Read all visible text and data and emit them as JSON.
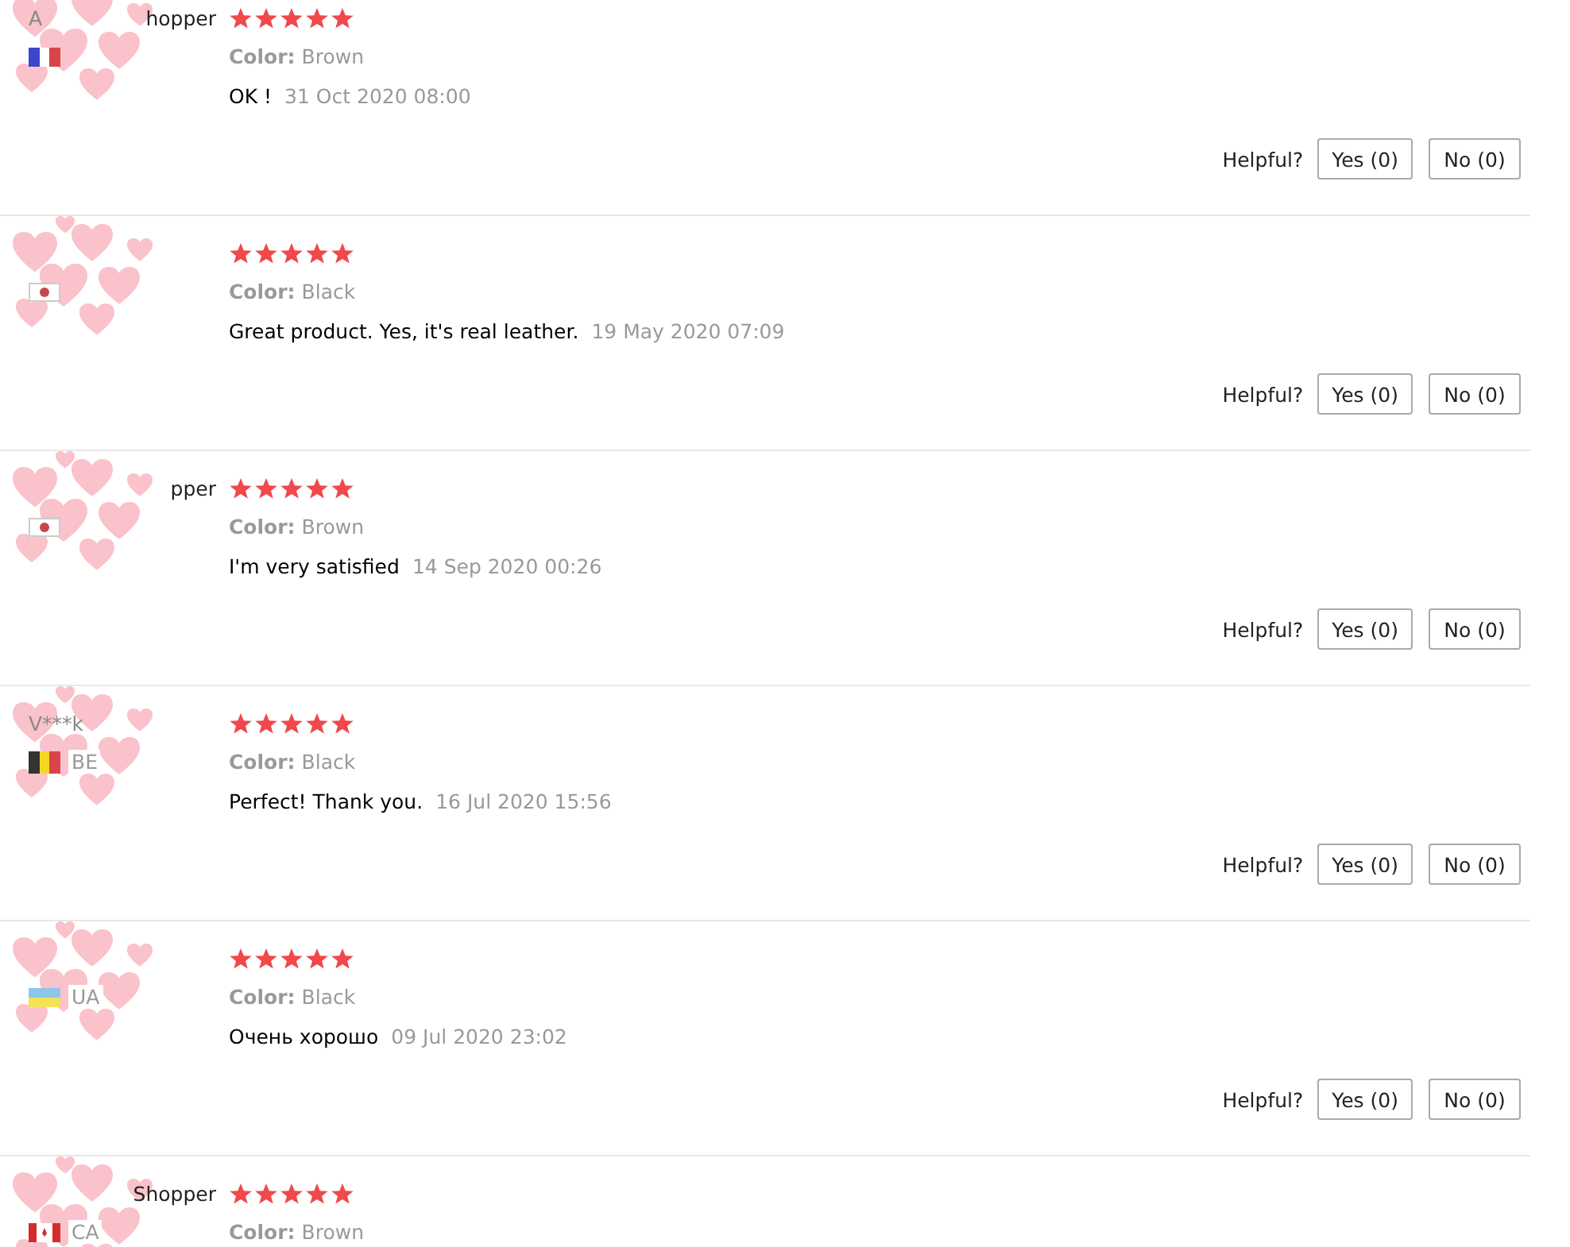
{
  "reviews": [
    {
      "user_name": "A",
      "user_name_end": "hopper",
      "flag": {
        "kind": "fr"
      },
      "stars": 5,
      "color_label": "Color:",
      "color_value": "Brown",
      "text": "OK !",
      "date": "31 Oct 2020 08:00",
      "helpful": {
        "label": "Helpful?",
        "yes": "Yes (0)",
        "no": "No (0)"
      }
    },
    {
      "flag": {
        "kind": "jp"
      },
      "stars": 5,
      "color_label": "Color:",
      "color_value": "Black",
      "text": "Great product. Yes, it's real leather.",
      "date": "19 May 2020 07:09",
      "helpful": {
        "label": "Helpful?",
        "yes": "Yes (0)",
        "no": "No (0)"
      }
    },
    {
      "user_name_end": "pper",
      "flag": {
        "kind": "jp"
      },
      "stars": 5,
      "color_label": "Color:",
      "color_value": "Brown",
      "text": "I'm very satisfied",
      "date": "14 Sep 2020 00:26",
      "helpful": {
        "label": "Helpful?",
        "yes": "Yes (0)",
        "no": "No (0)"
      }
    },
    {
      "user_name": "V***k",
      "flag": {
        "kind": "be"
      },
      "country": "BE",
      "stars": 5,
      "color_label": "Color:",
      "color_value": "Black",
      "text": "Perfect! Thank you.",
      "date": "16 Jul 2020 15:56",
      "helpful": {
        "label": "Helpful?",
        "yes": "Yes (0)",
        "no": "No (0)"
      }
    },
    {
      "flag": {
        "kind": "ua"
      },
      "country": "UA",
      "stars": 5,
      "color_label": "Color:",
      "color_value": "Black",
      "text": "Очень хорошо",
      "date": "09 Jul 2020 23:02",
      "helpful": {
        "label": "Helpful?",
        "yes": "Yes (0)",
        "no": "No (0)"
      }
    },
    {
      "user_name_end": "Shopper",
      "flag": {
        "kind": "ca"
      },
      "country": "CA",
      "stars": 5,
      "color_label": "Color:",
      "color_value": "Brown"
    }
  ]
}
